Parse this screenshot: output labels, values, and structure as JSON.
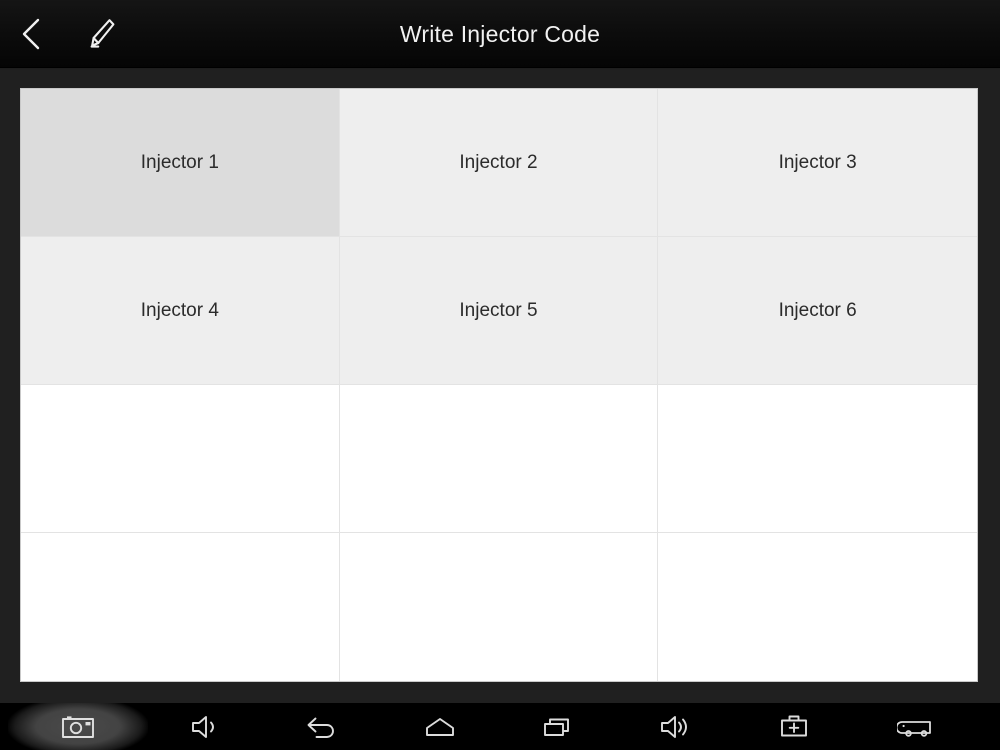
{
  "header": {
    "title": "Write Injector Code",
    "back_icon": "chevron-left-icon",
    "edit_icon": "pencil-icon"
  },
  "grid": {
    "columns": 3,
    "rows": 4,
    "cells": [
      {
        "label": "Injector 1",
        "state": "selected"
      },
      {
        "label": "Injector 2",
        "state": "filled"
      },
      {
        "label": "Injector 3",
        "state": "filled"
      },
      {
        "label": "Injector 4",
        "state": "filled"
      },
      {
        "label": "Injector 5",
        "state": "filled"
      },
      {
        "label": "Injector 6",
        "state": "filled"
      },
      {
        "label": "",
        "state": "empty"
      },
      {
        "label": "",
        "state": "empty"
      },
      {
        "label": "",
        "state": "empty"
      },
      {
        "label": "",
        "state": "empty"
      },
      {
        "label": "",
        "state": "empty"
      },
      {
        "label": "",
        "state": "empty"
      }
    ]
  },
  "navbar": {
    "items": [
      {
        "name": "screenshot-camera-button",
        "icon": "camera-icon",
        "highlight": true
      },
      {
        "name": "volume-down-button",
        "icon": "volume-low-icon",
        "highlight": false
      },
      {
        "name": "android-back-button",
        "icon": "back-arrow-icon",
        "highlight": false
      },
      {
        "name": "android-home-button",
        "icon": "home-icon",
        "highlight": false
      },
      {
        "name": "android-recents-button",
        "icon": "recent-apps-icon",
        "highlight": false
      },
      {
        "name": "volume-up-button",
        "icon": "volume-high-icon",
        "highlight": false
      },
      {
        "name": "toolbox-button",
        "icon": "toolbox-plus-icon",
        "highlight": false
      },
      {
        "name": "vehicle-button",
        "icon": "truck-icon",
        "highlight": false
      }
    ]
  },
  "colors": {
    "header_bg": "#0d0d0d",
    "app_bg": "#202020",
    "cell_empty": "#ffffff",
    "cell_filled": "#eeeeee",
    "cell_selected": "#dcdcdc",
    "cell_border": "#e3e3e3",
    "text_light": "#f2f2f2",
    "text_dark": "#2b2b2b",
    "navbar_bg": "#000000",
    "nav_icon": "#d8d8d8"
  }
}
